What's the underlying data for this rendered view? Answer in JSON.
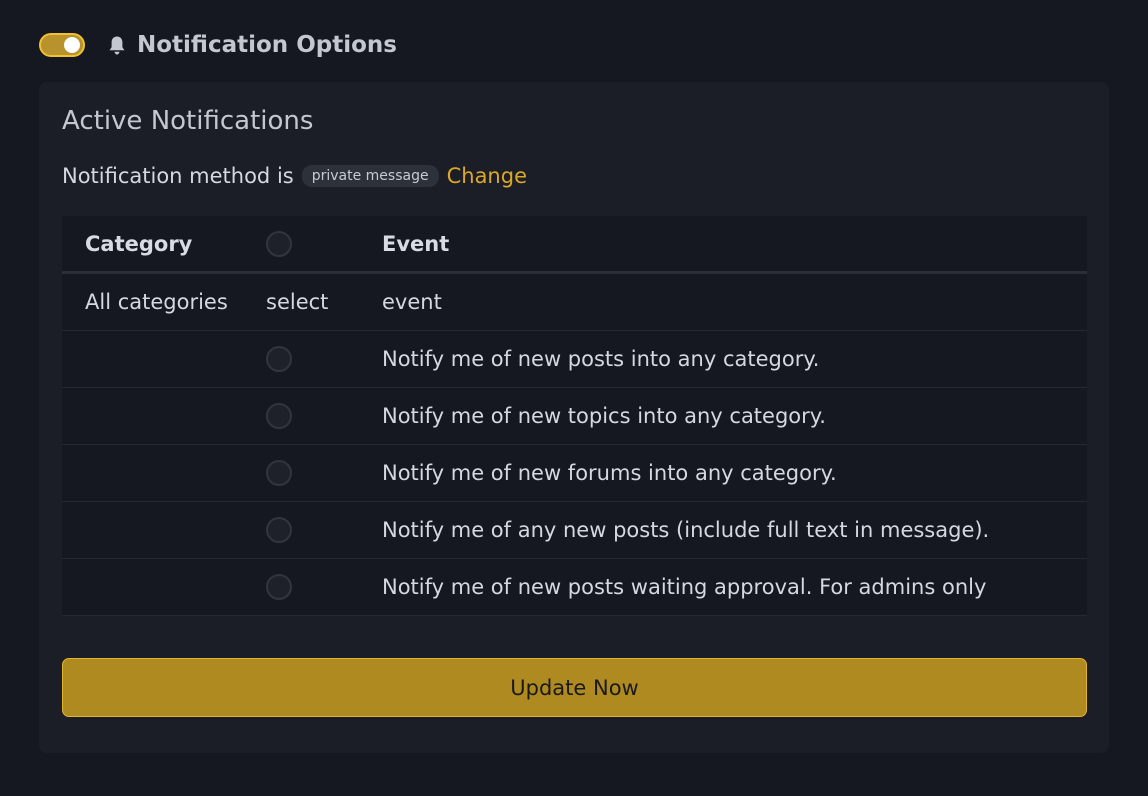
{
  "header": {
    "toggle_on": true,
    "bell_icon": "bell-icon",
    "title": "Notification Options"
  },
  "panel": {
    "title": "Active Notifications",
    "method_prefix": "Notification method is",
    "method_badge": "private message",
    "change_label": "Change"
  },
  "table": {
    "headers": {
      "category": "Category",
      "event": "Event"
    },
    "subheader": {
      "category": "All categories",
      "select": "select",
      "event": "event"
    },
    "rows": [
      {
        "event": "Notify me of new posts into any category."
      },
      {
        "event": "Notify me of new topics into any category."
      },
      {
        "event": "Notify me of new forums into any category."
      },
      {
        "event": "Notify me of any new posts (include full text in message)."
      },
      {
        "event": "Notify me of new posts waiting approval. For admins only"
      }
    ]
  },
  "update_button": "Update Now",
  "colors": {
    "accent": "#dca826",
    "button": "#ae8a21",
    "background": "#151820",
    "panel": "#1b1e26"
  }
}
